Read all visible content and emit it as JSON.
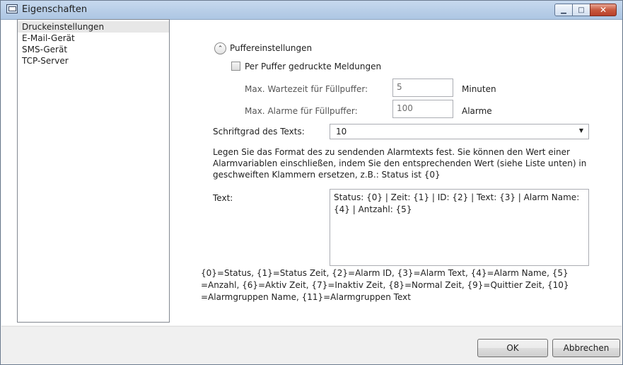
{
  "window": {
    "title": "Eigenschaften",
    "minimize_icon": "minimize-icon",
    "maximize_icon": "maximize-icon",
    "close_icon": "close-icon",
    "min_glyph": "▁",
    "max_glyph": "□",
    "close_glyph": "✕"
  },
  "sidebar": {
    "items": [
      {
        "label": "Druckeinstellungen",
        "selected": true
      },
      {
        "label": "E-Mail-Gerät",
        "selected": false
      },
      {
        "label": "SMS-Gerät",
        "selected": false
      },
      {
        "label": "TCP-Server",
        "selected": false
      }
    ]
  },
  "buffer": {
    "expander_glyph": "⌃",
    "section_title": "Puffereinstellungen",
    "checkbox_label": "Per Puffer gedruckte Meldungen",
    "checkbox_checked": false,
    "wait_label": "Max. Wartezeit für Füllpuffer:",
    "wait_value": "5",
    "wait_unit": "Minuten",
    "alarms_label": "Max. Alarme für Füllpuffer:",
    "alarms_value": "100",
    "alarms_unit": "Alarme"
  },
  "font": {
    "label": "Schriftgrad des Texts:",
    "value": "10",
    "arrow_glyph": "▼"
  },
  "description": "Legen Sie das Format des zu sendenden Alarmtexts fest. Sie können den Wert einer Alarmvariablen einschließen, indem Sie den entsprechenden Wert (siehe Liste unten) in geschweiften Klammern ersetzen, z.B.: Status ist {0}",
  "text_field": {
    "label": "Text:",
    "value": "Status: {0} | Zeit: {1} | ID: {2} | Text: {3} | Alarm Name: {4} | Antzahl: {5}"
  },
  "legend": "{0}=Status, {1}=Status Zeit, {2}=Alarm ID, {3}=Alarm Text, {4}=Alarm Name, {5} =Anzahl, {6}=Aktiv Zeit, {7}=Inaktiv Zeit, {8}=Normal Zeit, {9}=Quittier Zeit, {10} =Alarmgruppen Name, {11}=Alarmgruppen Text",
  "footer": {
    "ok_label": "OK",
    "cancel_label": "Abbrechen"
  },
  "colors": {
    "titlebar": "#b9cfe8",
    "close_button": "#c85a3f",
    "selection": "#e7e7e7"
  }
}
